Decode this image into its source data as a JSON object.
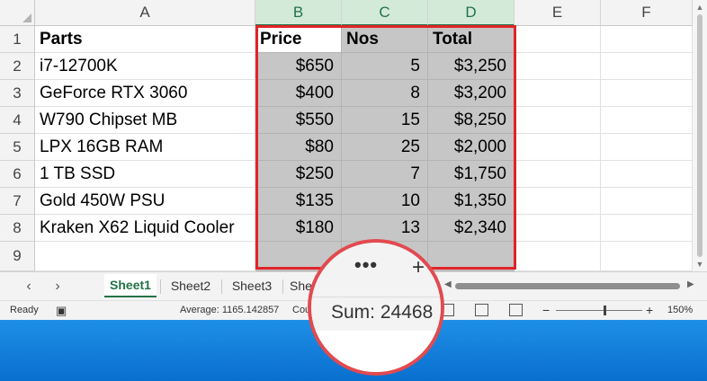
{
  "columns": [
    "A",
    "B",
    "C",
    "D",
    "E",
    "F"
  ],
  "rows": [
    "1",
    "2",
    "3",
    "4",
    "5",
    "6",
    "7",
    "8",
    "9"
  ],
  "header": {
    "parts": "Parts",
    "price": "Price",
    "nos": "Nos",
    "total": "Total"
  },
  "items": [
    {
      "part": "i7-12700K",
      "price": "$650",
      "nos": "5",
      "total": "$3,250"
    },
    {
      "part": "GeForce RTX 3060",
      "price": "$400",
      "nos": "8",
      "total": "$3,200"
    },
    {
      "part": "W790 Chipset MB",
      "price": "$550",
      "nos": "15",
      "total": "$8,250"
    },
    {
      "part": "LPX 16GB RAM",
      "price": "$80",
      "nos": "25",
      "total": "$2,000"
    },
    {
      "part": "1 TB SSD",
      "price": "$250",
      "nos": "7",
      "total": "$1,750"
    },
    {
      "part": "Gold 450W PSU",
      "price": "$135",
      "nos": "10",
      "total": "$1,350"
    },
    {
      "part": "Kraken X62 Liquid Cooler",
      "price": "$180",
      "nos": "13",
      "total": "$2,340"
    }
  ],
  "sheets": [
    "Sheet1",
    "Sheet2",
    "Sheet3",
    "She"
  ],
  "statusbar": {
    "ready": "Ready",
    "average": "Average: 1165.142857",
    "count": "Cou",
    "zoom_minus": "−",
    "zoom_plus": "+",
    "zoom": "150%"
  },
  "magnifier": {
    "dots": "•••",
    "plus": "+",
    "sum": "Sum: 24468"
  },
  "colors": {
    "selection_border": "#e0242a",
    "excel_green": "#217346",
    "selected_fill": "#c6c6c6",
    "desktop": "#0a78d7"
  }
}
